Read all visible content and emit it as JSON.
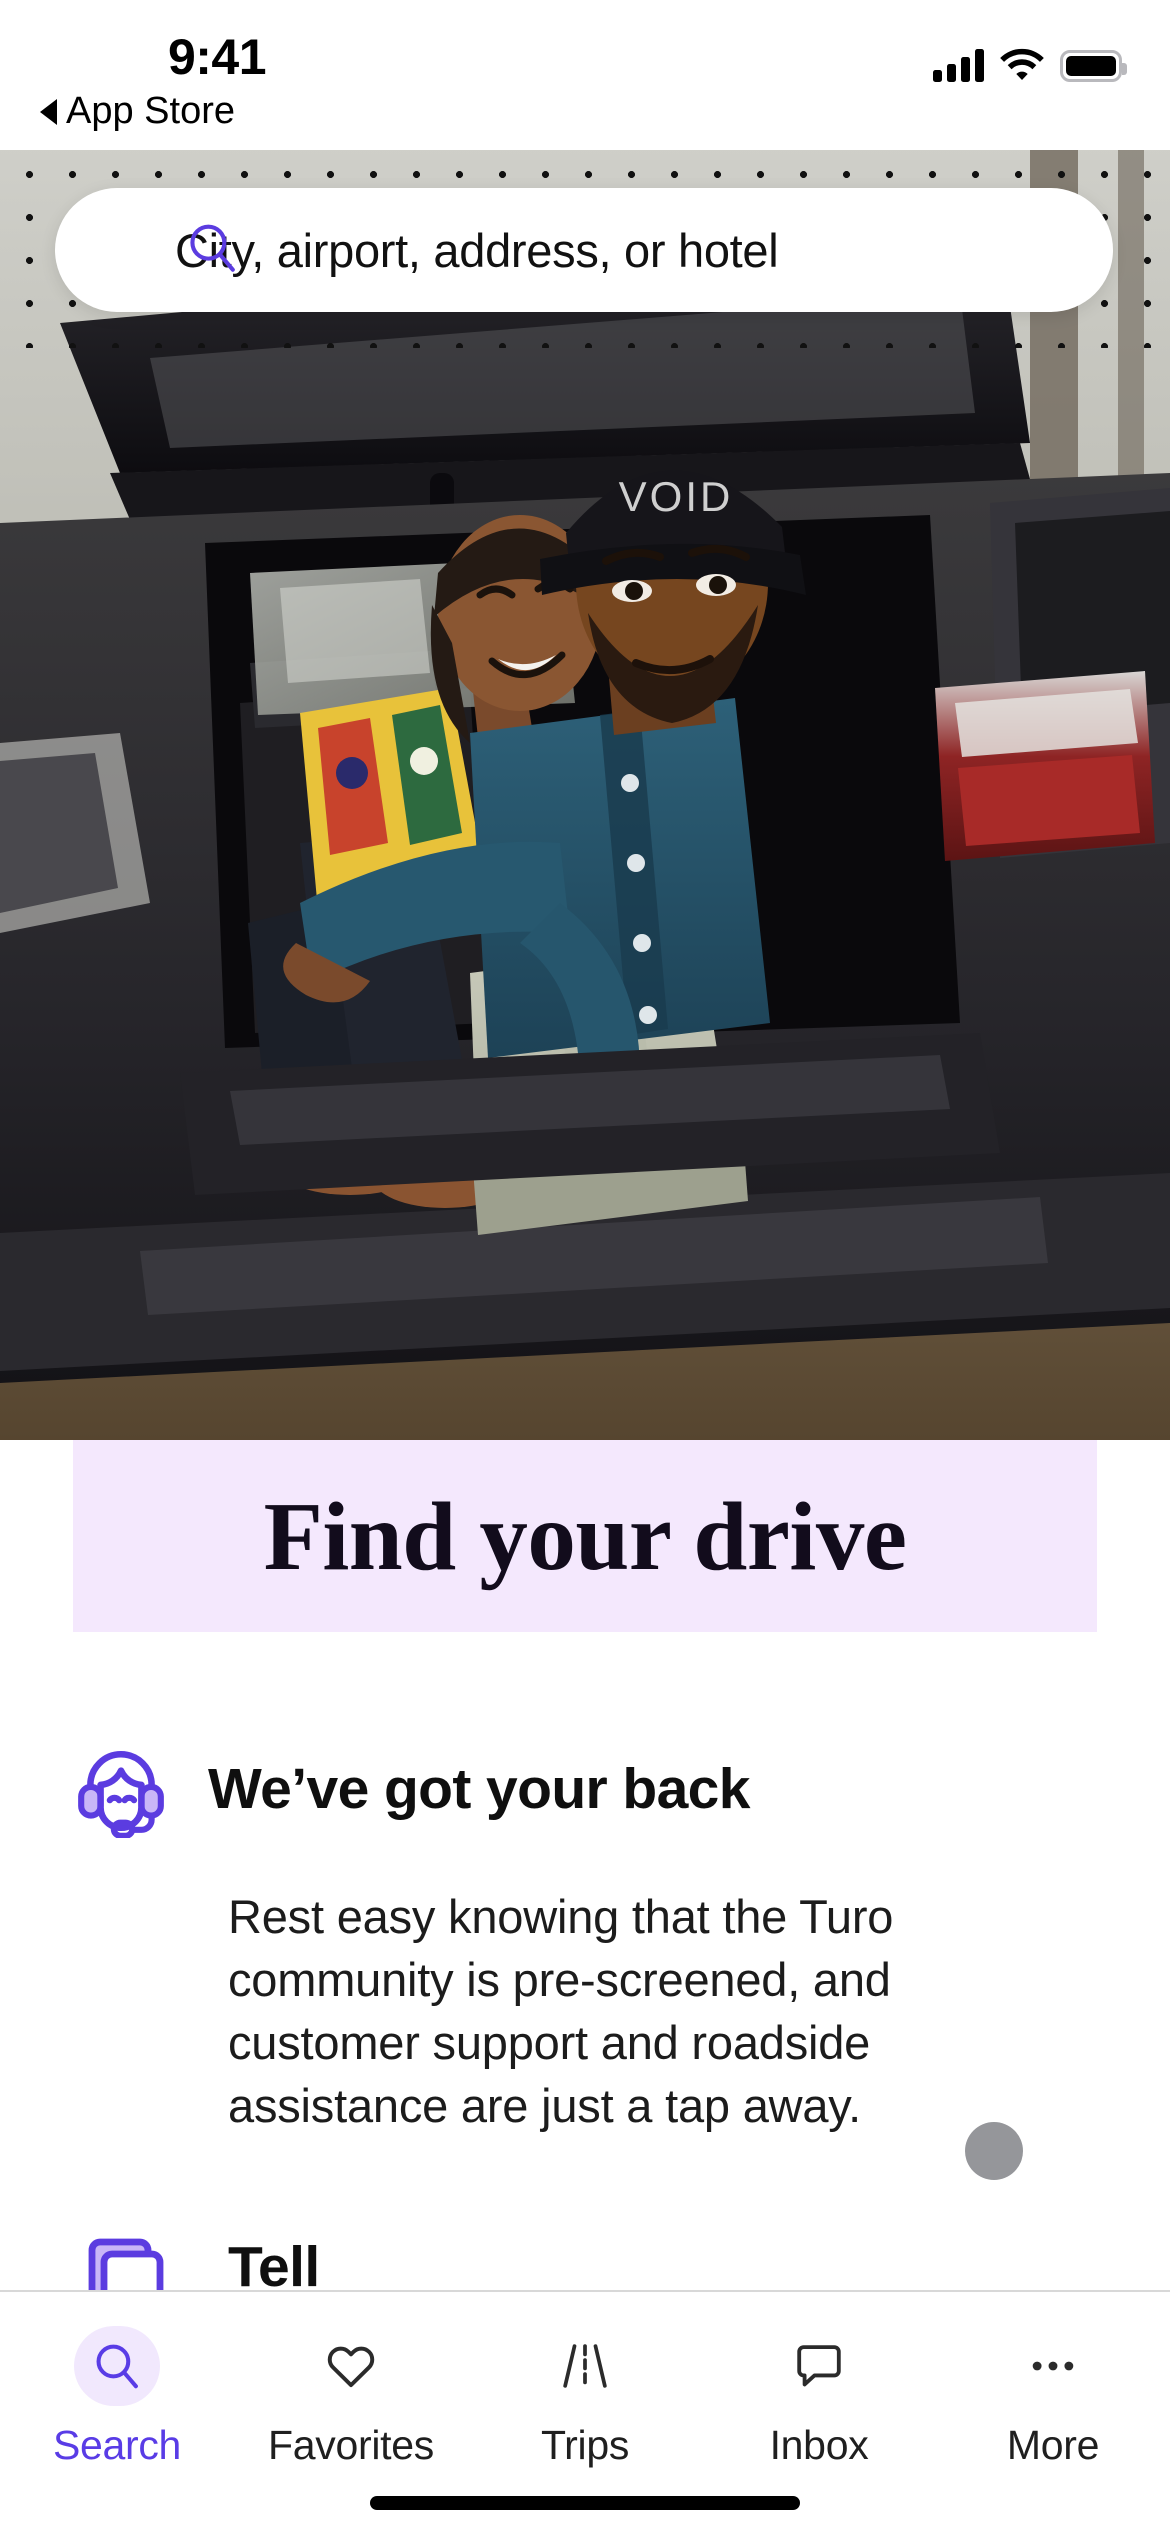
{
  "status_bar": {
    "time": "9:41",
    "back_label": "App Store",
    "cellular_icon": "cellular-bars-icon",
    "wifi_icon": "wifi-icon",
    "battery_icon": "battery-full-icon"
  },
  "search": {
    "icon": "search-icon",
    "placeholder": "City, airport, address, or hotel",
    "value": "",
    "accent_color": "#5b3ce0"
  },
  "hero": {
    "alt": "Couple sitting in the open trunk of an SUV",
    "overlay_pattern": "polka-dots"
  },
  "banner": {
    "title": "Find your drive",
    "background_color": "#f4e8fd",
    "text_color": "#120c1c"
  },
  "feature": {
    "icon": "headset-support-icon",
    "title": "We’ve got your back",
    "body": "Rest easy knowing that the Turo community is pre-screened, and customer support and roadside assistance are just a tap away.",
    "accent_color": "#5b3ce0"
  },
  "scroll_dot": {
    "name": "page-indicator-dot",
    "color": "#95969a"
  },
  "next_section": {
    "icon": "document-icon",
    "title": "Tell"
  },
  "tab_bar": {
    "active": "Search",
    "active_color": "#593ce6",
    "items": [
      {
        "label": "Search",
        "icon": "search-icon"
      },
      {
        "label": "Favorites",
        "icon": "heart-icon"
      },
      {
        "label": "Trips",
        "icon": "road-icon"
      },
      {
        "label": "Inbox",
        "icon": "chat-bubble-icon"
      },
      {
        "label": "More",
        "icon": "ellipsis-icon"
      }
    ]
  }
}
